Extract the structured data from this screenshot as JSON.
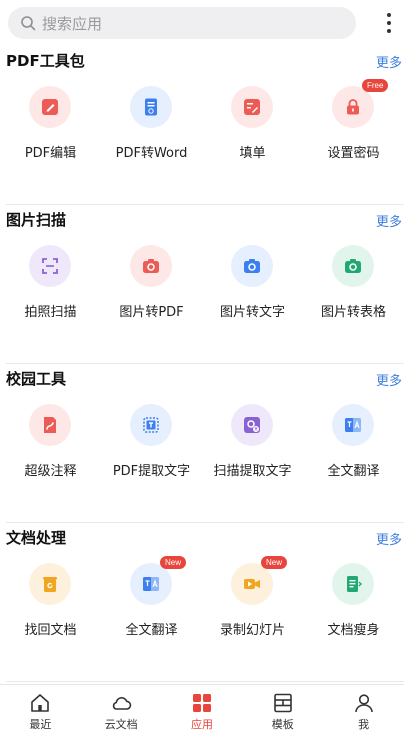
{
  "search": {
    "placeholder": "搜索应用"
  },
  "accent_color": "#e8453c",
  "link_color": "#3d7fe0",
  "sections": [
    {
      "title": "PDF工具包",
      "more": "更多",
      "tools": [
        {
          "label": "PDF编辑",
          "icon": "edit-icon"
        },
        {
          "label": "PDF转Word",
          "icon": "word-icon"
        },
        {
          "label": "填单",
          "icon": "form-fill-icon"
        },
        {
          "label": "设置密码",
          "icon": "lock-icon",
          "badge": "Free"
        }
      ]
    },
    {
      "title": "图片扫描",
      "more": "更多",
      "tools": [
        {
          "label": "拍照扫描",
          "icon": "scan-icon"
        },
        {
          "label": "图片转PDF",
          "icon": "camera-pdf-icon"
        },
        {
          "label": "图片转文字",
          "icon": "camera-text-icon"
        },
        {
          "label": "图片转表格",
          "icon": "camera-table-icon"
        }
      ]
    },
    {
      "title": "校园工具",
      "more": "更多",
      "tools": [
        {
          "label": "超级注释",
          "icon": "annotate-icon"
        },
        {
          "label": "PDF提取文字",
          "icon": "extract-text-icon"
        },
        {
          "label": "扫描提取文字",
          "icon": "scan-extract-icon"
        },
        {
          "label": "全文翻译",
          "icon": "translate-icon"
        }
      ]
    },
    {
      "title": "文档处理",
      "more": "更多",
      "tools": [
        {
          "label": "找回文档",
          "icon": "recover-icon"
        },
        {
          "label": "全文翻译",
          "icon": "translate-icon",
          "badge": "New"
        },
        {
          "label": "录制幻灯片",
          "icon": "record-slides-icon",
          "badge": "New"
        },
        {
          "label": "文档瘦身",
          "icon": "slim-doc-icon"
        }
      ]
    }
  ],
  "tabbar": [
    {
      "label": "最近",
      "icon": "home-icon"
    },
    {
      "label": "云文档",
      "icon": "cloud-icon"
    },
    {
      "label": "应用",
      "icon": "apps-grid-icon",
      "active": true
    },
    {
      "label": "模板",
      "icon": "template-icon"
    },
    {
      "label": "我",
      "icon": "user-icon"
    }
  ]
}
